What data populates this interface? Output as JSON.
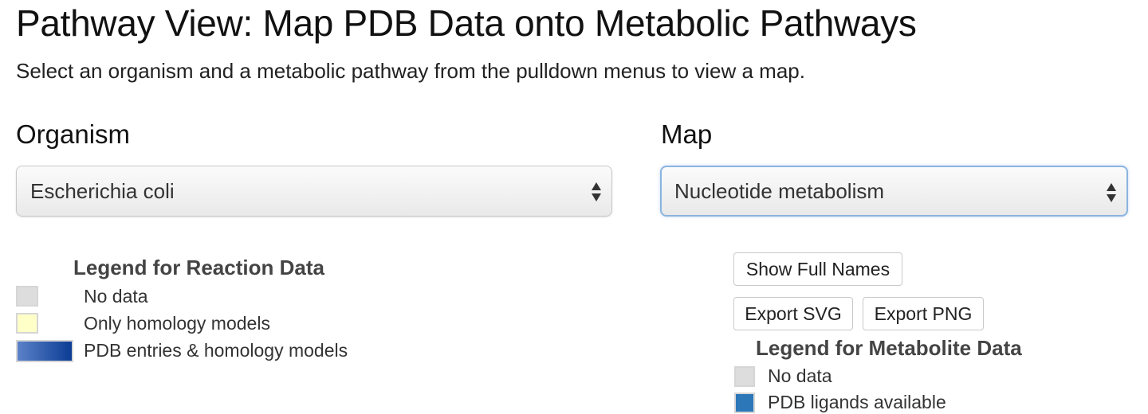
{
  "page": {
    "title": "Pathway View: Map PDB Data onto Metabolic Pathways",
    "subtitle": "Select an organism and a metabolic pathway from the pulldown menus to view a map."
  },
  "organism": {
    "label": "Organism",
    "selected": "Escherichia coli",
    "icon": "updown-arrows-icon"
  },
  "map": {
    "label": "Map",
    "selected": "Nucleotide metabolism",
    "icon": "updown-arrows-icon"
  },
  "reaction_legend": {
    "title": "Legend for Reaction Data",
    "items": [
      {
        "label": "No data",
        "color": "#dddddd"
      },
      {
        "label": "Only homology models",
        "color": "#ffffc8"
      },
      {
        "label": "PDB entries & homology models",
        "color_start": "#5b82c8",
        "color_end": "#0b3c94"
      }
    ]
  },
  "toolbar": {
    "show_full_names": "Show Full Names",
    "export_svg": "Export SVG",
    "export_png": "Export PNG"
  },
  "metabolite_legend": {
    "title": "Legend for Metabolite Data",
    "items": [
      {
        "label": "No data",
        "color": "#dddddd"
      },
      {
        "label": "PDB ligands available",
        "color": "#2c77b8"
      }
    ]
  },
  "colors": {
    "focus_border": "#8ab4e0",
    "legend_title": "#444444"
  }
}
